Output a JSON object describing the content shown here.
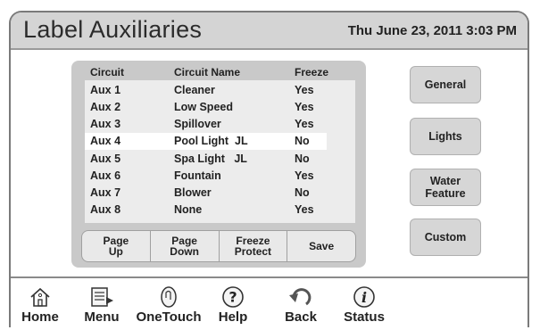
{
  "header": {
    "title": "Label Auxiliaries",
    "datetime": "Thu June 23, 2011   3:03 PM"
  },
  "table": {
    "columns": [
      "Circuit",
      "Circuit Name",
      "Freeze"
    ],
    "rows": [
      {
        "circuit": "Aux 1",
        "name": "Cleaner",
        "freeze": "Yes"
      },
      {
        "circuit": "Aux 2",
        "name": "Low Speed",
        "freeze": "Yes"
      },
      {
        "circuit": "Aux 3",
        "name": "Spillover",
        "freeze": "Yes"
      },
      {
        "circuit": "Aux 4",
        "name": "Pool Light  JL",
        "freeze": "No"
      },
      {
        "circuit": "Aux 5",
        "name": "Spa Light   JL",
        "freeze": "No"
      },
      {
        "circuit": "Aux 6",
        "name": "Fountain",
        "freeze": "Yes"
      },
      {
        "circuit": "Aux 7",
        "name": "Blower",
        "freeze": "No"
      },
      {
        "circuit": "Aux 8",
        "name": "None",
        "freeze": "Yes"
      }
    ],
    "selected_row": "Aux 4"
  },
  "panel_buttons": {
    "page_up": "Page\nUp",
    "page_down": "Page\nDown",
    "freeze_protect": "Freeze\nProtect",
    "save": "Save"
  },
  "side_buttons": {
    "general": "General",
    "lights": "Lights",
    "water_feature": "Water\nFeature",
    "custom": "Custom"
  },
  "nav": {
    "home": "Home",
    "menu": "Menu",
    "onetouch": "OneTouch",
    "help": "Help",
    "back": "Back",
    "status": "Status"
  },
  "icons": {
    "home": "home-icon",
    "menu": "menu-icon",
    "onetouch": "onetouch-icon",
    "help": "help-icon",
    "back": "back-icon",
    "status": "status-icon"
  },
  "colors": {
    "header_bg": "#d4d4d4",
    "panel_bg": "#c9c9c9",
    "selected_row_bg": "#ffffff"
  }
}
